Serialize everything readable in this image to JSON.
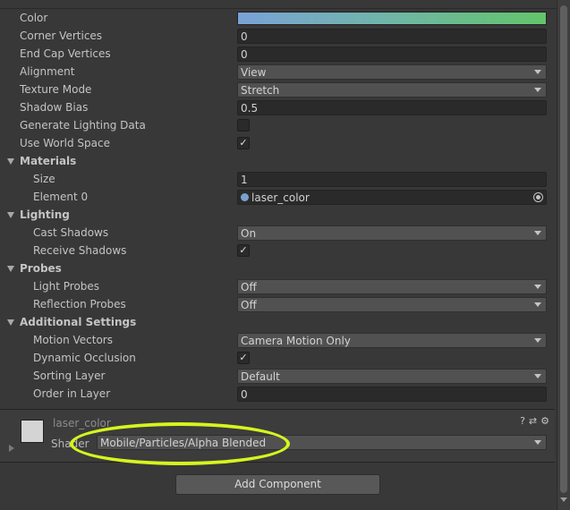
{
  "properties": [
    {
      "id": "color",
      "label": "Color",
      "kind": "color"
    },
    {
      "id": "corner-vertices",
      "label": "Corner Vertices",
      "kind": "field",
      "value": "0"
    },
    {
      "id": "end-cap-vertices",
      "label": "End Cap Vertices",
      "kind": "field",
      "value": "0"
    },
    {
      "id": "alignment",
      "label": "Alignment",
      "kind": "dropdown",
      "value": "View"
    },
    {
      "id": "texture-mode",
      "label": "Texture Mode",
      "kind": "dropdown",
      "value": "Stretch"
    },
    {
      "id": "shadow-bias",
      "label": "Shadow Bias",
      "kind": "field",
      "value": "0.5"
    },
    {
      "id": "generate-lighting-data",
      "label": "Generate Lighting Data",
      "kind": "checkbox",
      "checked": false
    },
    {
      "id": "use-world-space",
      "label": "Use World Space",
      "kind": "checkbox",
      "checked": true
    }
  ],
  "materials": {
    "title": "Materials",
    "size_label": "Size",
    "size_value": "1",
    "element0_label": "Element 0",
    "element0_value": "laser_color"
  },
  "lighting": {
    "title": "Lighting",
    "cast_shadows_label": "Cast Shadows",
    "cast_shadows_value": "On",
    "receive_shadows_label": "Receive Shadows",
    "receive_shadows_checked": true
  },
  "probes": {
    "title": "Probes",
    "light_probes_label": "Light Probes",
    "light_probes_value": "Off",
    "reflection_probes_label": "Reflection Probes",
    "reflection_probes_value": "Off"
  },
  "additional": {
    "title": "Additional Settings",
    "motion_vectors_label": "Motion Vectors",
    "motion_vectors_value": "Camera Motion Only",
    "dynamic_occlusion_label": "Dynamic Occlusion",
    "dynamic_occlusion_checked": true,
    "sorting_layer_label": "Sorting Layer",
    "sorting_layer_value": "Default",
    "order_in_layer_label": "Order in Layer",
    "order_in_layer_value": "0"
  },
  "material_panel": {
    "name": "laser_color",
    "shader_label": "Shader",
    "shader_value": "Mobile/Particles/Alpha Blended"
  },
  "add_component_label": "Add Component",
  "colors": {
    "panel_bg": "#383838",
    "highlight": "#d6f51e",
    "gradient_start": "#7aa2d6",
    "gradient_end": "#63c46a"
  }
}
